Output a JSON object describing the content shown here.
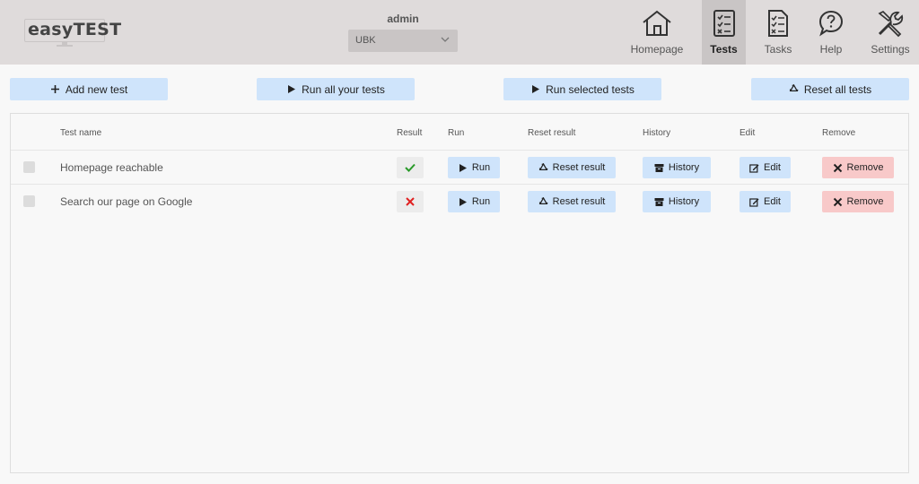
{
  "header": {
    "logo_text": "easyTEST",
    "user_name": "admin",
    "org_select": {
      "value": "UBK"
    },
    "nav": [
      {
        "label": "Homepage",
        "icon": "home-icon",
        "active": false
      },
      {
        "label": "Tests",
        "icon": "tests-checklist-icon",
        "active": true
      },
      {
        "label": "Tasks",
        "icon": "tasks-list-icon",
        "active": false
      },
      {
        "label": "Help",
        "icon": "help-icon",
        "active": false
      },
      {
        "label": "Settings",
        "icon": "settings-tools-icon",
        "active": false
      }
    ]
  },
  "toolbar": {
    "add_label": "Add new test",
    "run_all_label": "Run all your tests",
    "run_selected_label": "Run selected tests",
    "reset_all_label": "Reset all tests"
  },
  "table": {
    "columns": {
      "name": "Test name",
      "result": "Result",
      "run": "Run",
      "reset": "Reset result",
      "history": "History",
      "edit": "Edit",
      "remove": "Remove"
    },
    "rows": [
      {
        "name": "Homepage reachable",
        "result": "pass",
        "run_label": "Run",
        "reset_label": "Reset result",
        "history_label": "History",
        "edit_label": "Edit",
        "remove_label": "Remove"
      },
      {
        "name": "Search our page on Google",
        "result": "fail",
        "run_label": "Run",
        "reset_label": "Reset result",
        "history_label": "History",
        "edit_label": "Edit",
        "remove_label": "Remove"
      }
    ]
  },
  "colors": {
    "header_bg": "#dfdbdb",
    "active_nav_bg": "#c9c5c5",
    "button_blue": "#cfe4fb",
    "button_red": "#f8c9c9",
    "pass_green": "#2a9a2a",
    "fail_red": "#e02020"
  }
}
